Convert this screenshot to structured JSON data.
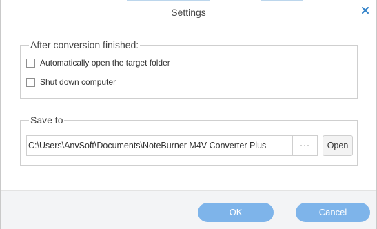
{
  "window": {
    "title": "Settings",
    "close_icon": "close-icon"
  },
  "after_conversion": {
    "legend": "After conversion finished:",
    "options": [
      {
        "label": "Automatically open the target folder",
        "checked": false
      },
      {
        "label": "Shut down computer",
        "checked": false
      }
    ]
  },
  "save_to": {
    "legend": "Save to",
    "path_value": "C:\\Users\\AnvSoft\\Documents\\NoteBurner M4V Converter Plus",
    "browse_label": "···",
    "open_label": "Open"
  },
  "footer": {
    "ok_label": "OK",
    "cancel_label": "Cancel"
  },
  "colors": {
    "accent": "#7eb4ea",
    "close_icon": "#2f80c8",
    "border": "#cfcfcf",
    "footer_bg": "#f3f4f6"
  }
}
